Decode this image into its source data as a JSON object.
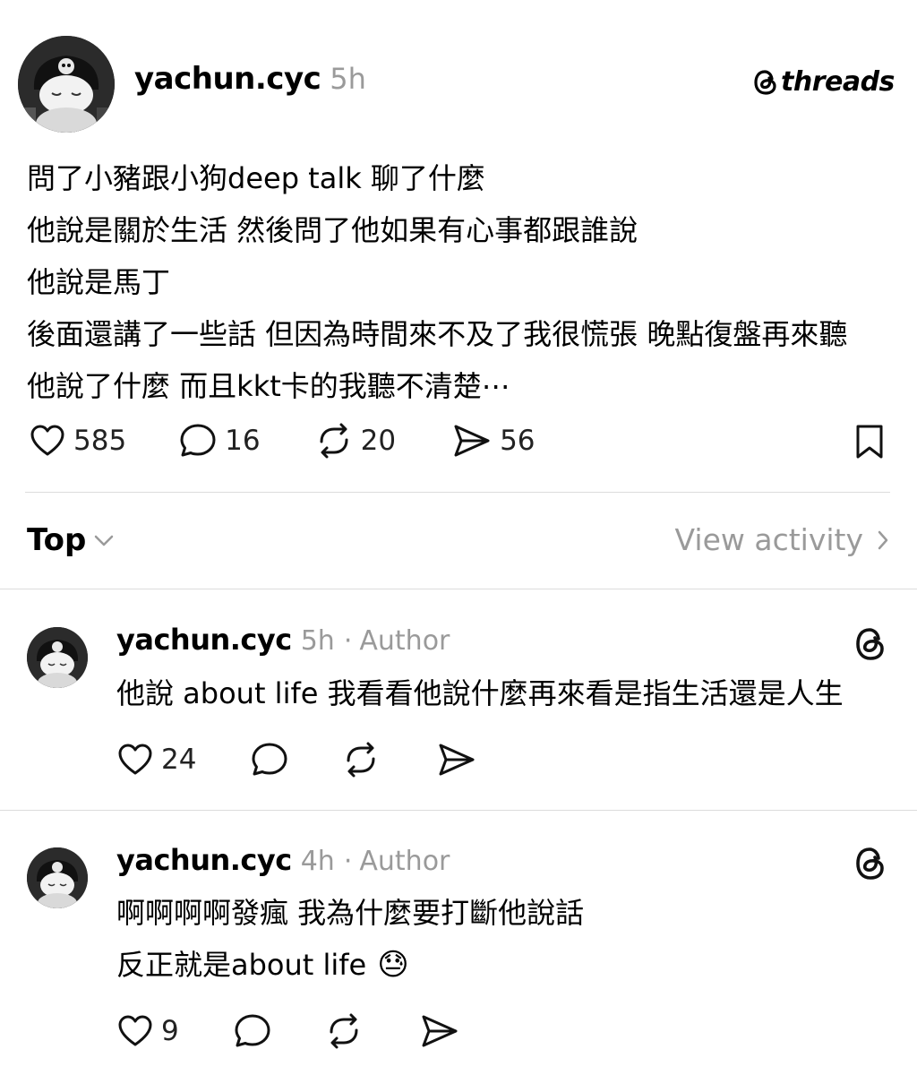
{
  "post": {
    "username": "yachun.cyc",
    "time": "5h",
    "brand": "threads",
    "lines": [
      "問了小豬跟小狗deep talk 聊了什麼",
      "他說是關於生活 然後問了他如果有心事都跟誰說",
      "他說是馬丁",
      "後面還講了一些話 但因為時間來不及了我很慌張 晚點復盤再來聽",
      "他說了什麼 而且kkt卡的我聽不清楚⋯"
    ],
    "likes": "585",
    "comments": "16",
    "reposts": "20",
    "shares": "56"
  },
  "sort": {
    "label": "Top",
    "view_activity": "View activity"
  },
  "replies": [
    {
      "username": "yachun.cyc",
      "time": "5h",
      "separator": "·",
      "role": "Author",
      "lines": [
        "他說 about life 我看看他說什麼再來看是指生活還是人生"
      ],
      "likes": "24"
    },
    {
      "username": "yachun.cyc",
      "time": "4h",
      "separator": "·",
      "role": "Author",
      "lines": [
        "啊啊啊啊發瘋 我為什麼要打斷他說話",
        "反正就是about life"
      ],
      "emoji": "😓",
      "likes": "9"
    }
  ],
  "icons": {
    "like": "heart-icon",
    "comment": "comment-bubble-icon",
    "repost": "repost-icon",
    "share": "send-icon",
    "save": "bookmark-icon",
    "brand": "threads-logo-icon",
    "chevron_down": "chevron-down-icon",
    "chevron_right": "chevron-right-icon"
  }
}
